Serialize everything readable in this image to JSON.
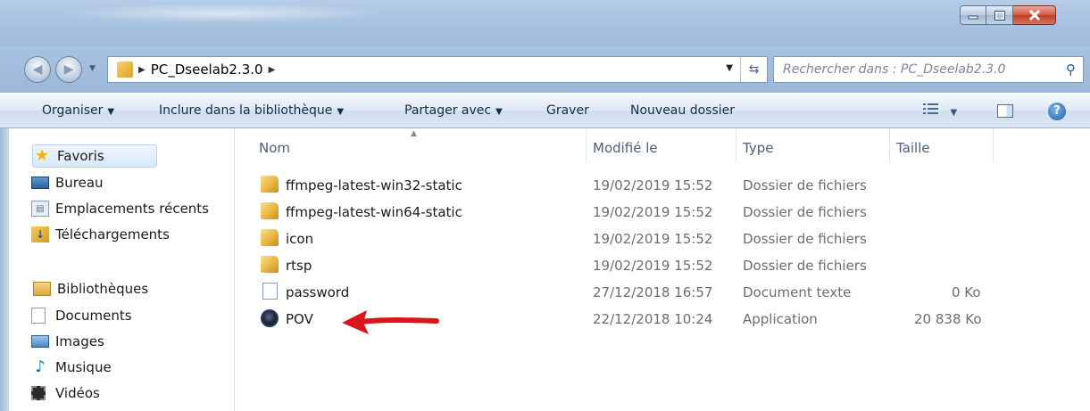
{
  "window": {
    "colors": {
      "title_bar": "#a9c3e1",
      "close_button": "#c23d27",
      "selection": "#d9e9fa"
    }
  },
  "address_bar": {
    "breadcrumb": [
      "PC_Dseelab2.3.0"
    ],
    "search_placeholder": "Rechercher dans : PC_Dseelab2.3.0"
  },
  "toolbar": {
    "organiser": "Organiser",
    "include_library": "Inclure dans la bibliothèque",
    "share_with": "Partager avec",
    "burn": "Graver",
    "new_folder": "Nouveau dossier"
  },
  "sidebar": {
    "favorites": {
      "label": "Favoris",
      "items": [
        {
          "label": "Bureau",
          "icon": "desktop-icon"
        },
        {
          "label": "Emplacements récents",
          "icon": "recent-places-icon"
        },
        {
          "label": "Téléchargements",
          "icon": "downloads-icon"
        }
      ]
    },
    "libraries": {
      "label": "Bibliothèques",
      "items": [
        {
          "label": "Documents",
          "icon": "documents-icon"
        },
        {
          "label": "Images",
          "icon": "pictures-icon"
        },
        {
          "label": "Musique",
          "icon": "music-icon"
        },
        {
          "label": "Vidéos",
          "icon": "videos-icon"
        }
      ]
    }
  },
  "file_list": {
    "columns": [
      "Nom",
      "Modifié le",
      "Type",
      "Taille"
    ],
    "rows": [
      {
        "name": "ffmpeg-latest-win32-static",
        "modified": "19/02/2019 15:52",
        "type": "Dossier de fichiers",
        "size": "",
        "icon": "folder-icon"
      },
      {
        "name": "ffmpeg-latest-win64-static",
        "modified": "19/02/2019 15:52",
        "type": "Dossier de fichiers",
        "size": "",
        "icon": "folder-icon"
      },
      {
        "name": "icon",
        "modified": "19/02/2019 15:52",
        "type": "Dossier de fichiers",
        "size": "",
        "icon": "folder-icon"
      },
      {
        "name": "rtsp",
        "modified": "19/02/2019 15:52",
        "type": "Dossier de fichiers",
        "size": "",
        "icon": "folder-icon"
      },
      {
        "name": "password",
        "modified": "27/12/2018 16:57",
        "type": "Document texte",
        "size": "0 Ko",
        "icon": "text-file-icon"
      },
      {
        "name": "POV",
        "modified": "22/12/2018 10:24",
        "type": "Application",
        "size": "20 838 Ko",
        "icon": "application-icon"
      }
    ]
  },
  "annotation": {
    "arrow_color": "#d9161b"
  }
}
